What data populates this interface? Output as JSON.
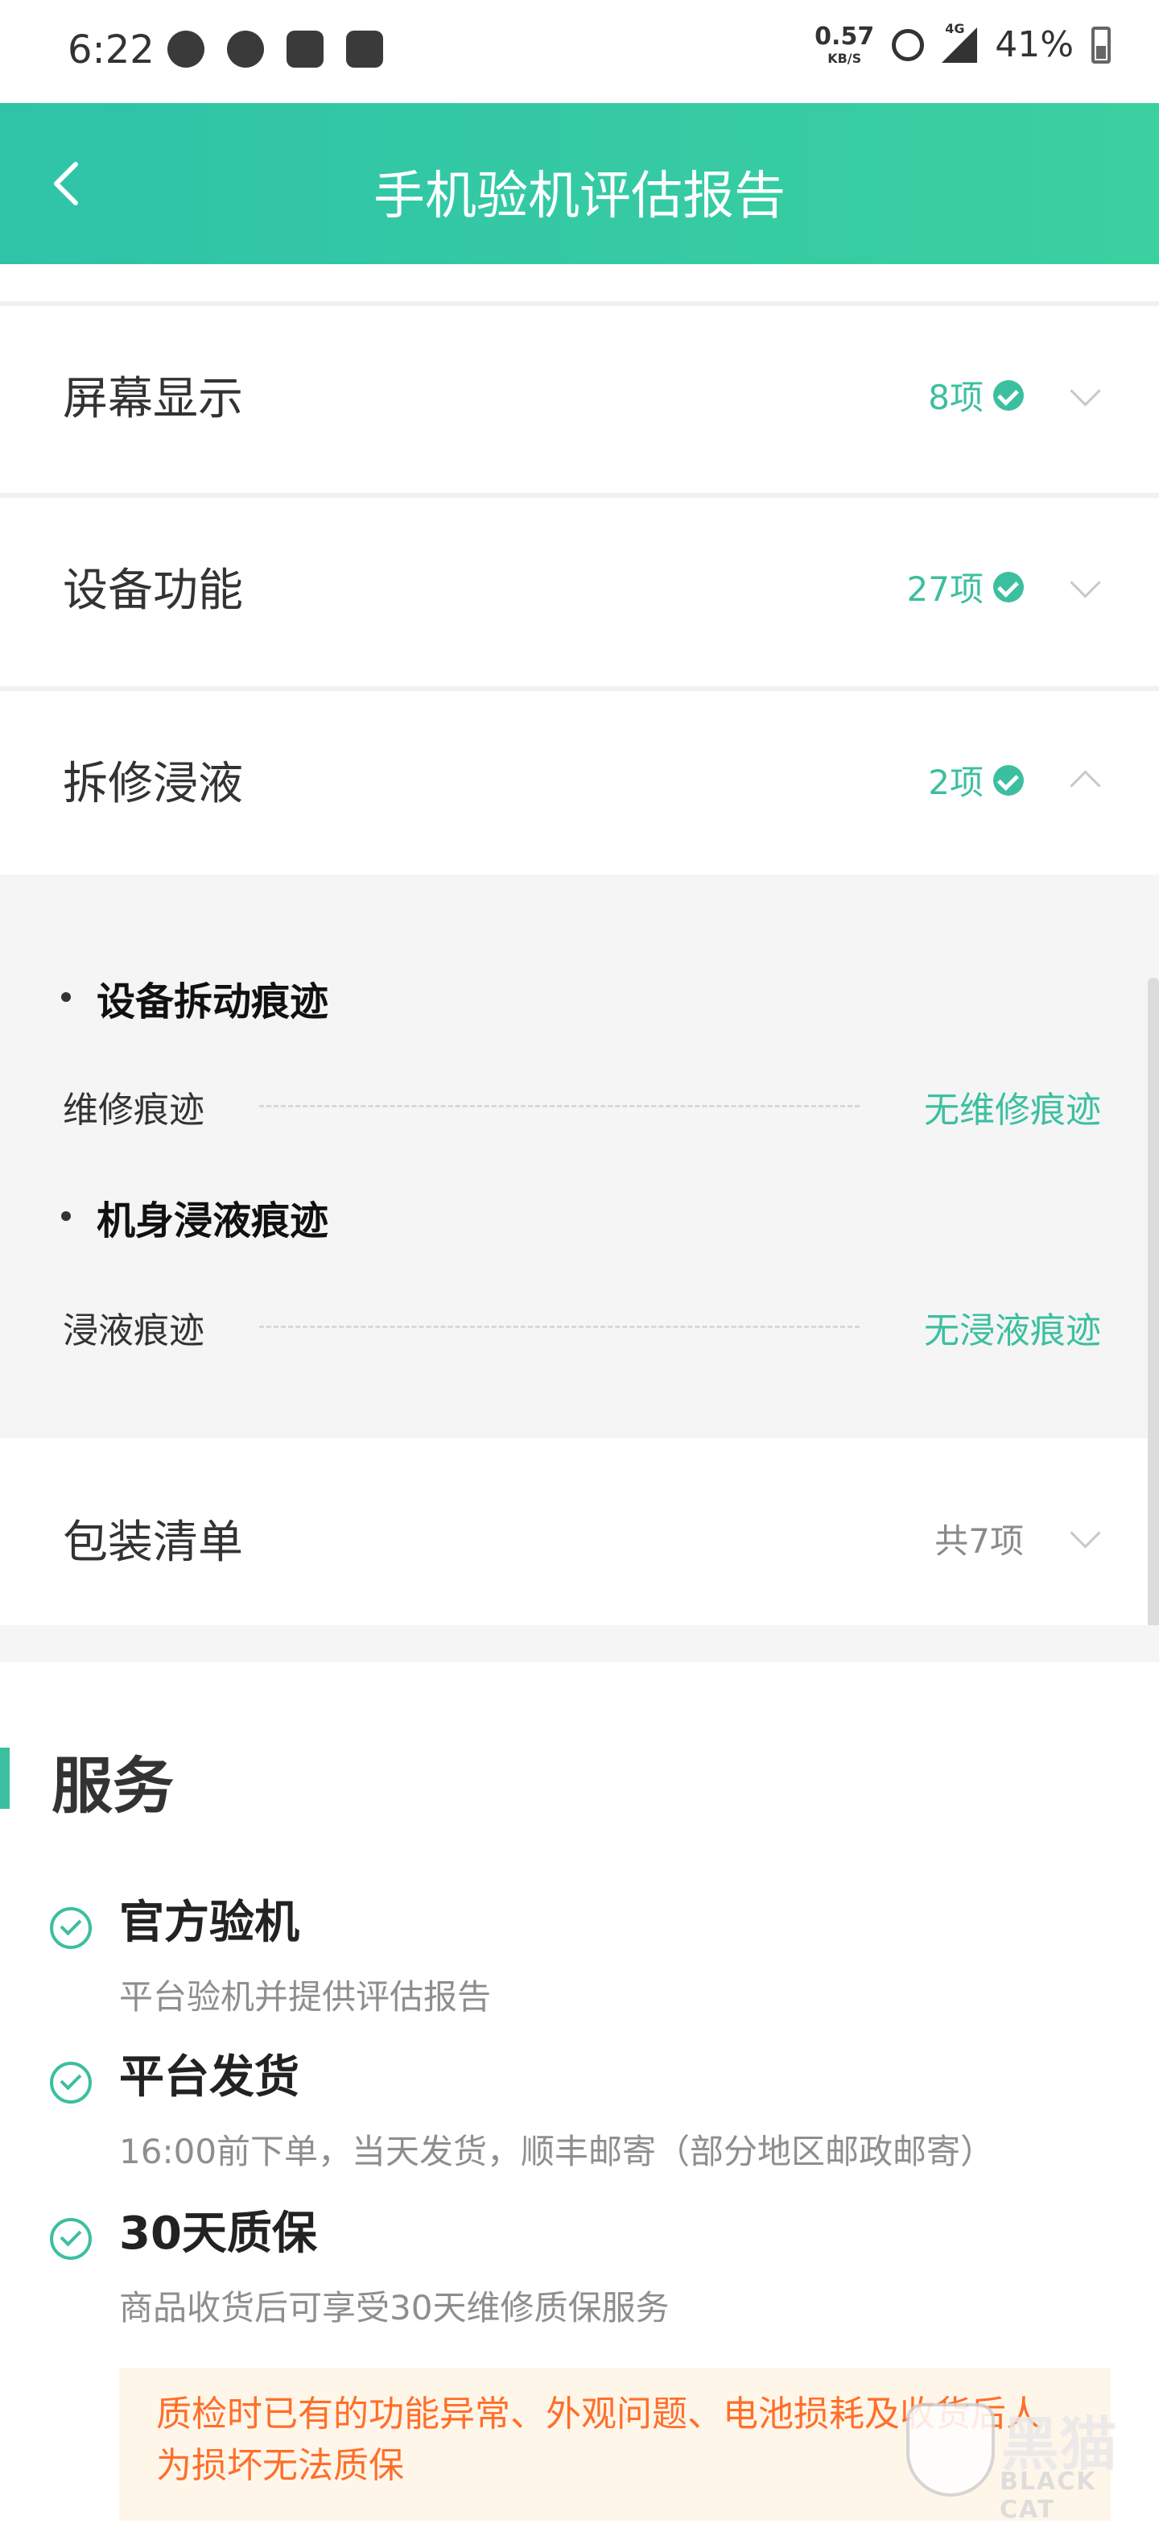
{
  "status_bar": {
    "time": "6:22",
    "net_speed": "0.57",
    "net_unit": "KB/S",
    "network": "4G",
    "battery": "41%"
  },
  "header": {
    "title": "手机验机评估报告"
  },
  "sections": [
    {
      "title": "屏幕显示",
      "count": "8项",
      "expanded": false
    },
    {
      "title": "设备功能",
      "count": "27项",
      "expanded": false
    },
    {
      "title": "拆修浸液",
      "count": "2项",
      "expanded": true
    },
    {
      "title": "包装清单",
      "count": "共7项",
      "expanded": false
    }
  ],
  "detail": {
    "groups": [
      {
        "heading": "设备拆动痕迹",
        "label": "维修痕迹",
        "value": "无维修痕迹"
      },
      {
        "heading": "机身浸液痕迹",
        "label": "浸液痕迹",
        "value": "无浸液痕迹"
      }
    ]
  },
  "services": {
    "title": "服务",
    "items": [
      {
        "name": "官方验机",
        "desc": "平台验机并提供评估报告"
      },
      {
        "name": "平台发货",
        "desc": "16:00前下单，当天发货，顺丰邮寄（部分地区邮政邮寄）"
      },
      {
        "name": "30天质保",
        "desc": "商品收货后可享受30天维修质保服务"
      }
    ],
    "notice": "质检时已有的功能异常、外观问题、电池损耗及收货后人为损坏无法质保"
  },
  "watermark": {
    "cn": "黑猫",
    "en": "BLACK CAT"
  },
  "colors": {
    "accent": "#3cbfa0",
    "header_start": "#2fc3a8",
    "header_end": "#3ad0a0",
    "notice_text": "#ff6f2a"
  }
}
